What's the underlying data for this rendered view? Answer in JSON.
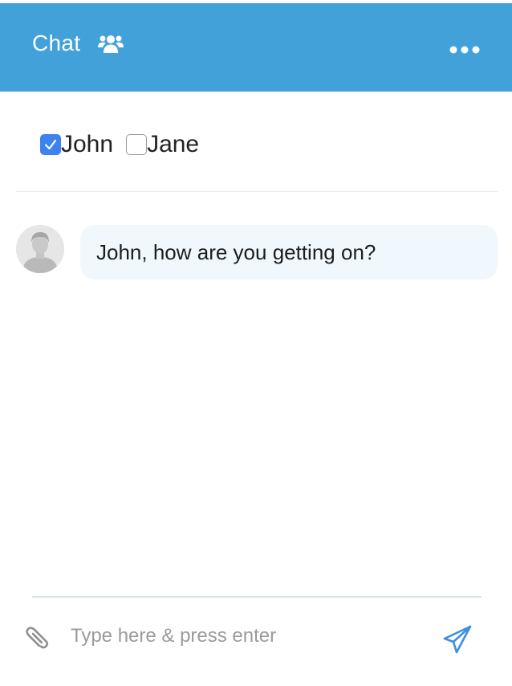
{
  "header": {
    "title": "Chat",
    "group_icon": "users-group-icon",
    "menu_icon": "ellipsis-horizontal-icon",
    "background_color": "#42a1d9"
  },
  "participants": [
    {
      "name": "John",
      "checked": true
    },
    {
      "name": "Jane",
      "checked": false
    }
  ],
  "messages": [
    {
      "avatar_icon": "user-avatar-icon",
      "text": "John, how are you getting on?"
    }
  ],
  "composer": {
    "attach_icon": "paperclip-icon",
    "placeholder": "Type here & press enter",
    "value": "",
    "send_icon": "paper-plane-send-icon"
  },
  "colors": {
    "accent": "#42a1d9",
    "checkbox_checked": "#3d82f0",
    "bubble_background": "#f1f8fd"
  }
}
